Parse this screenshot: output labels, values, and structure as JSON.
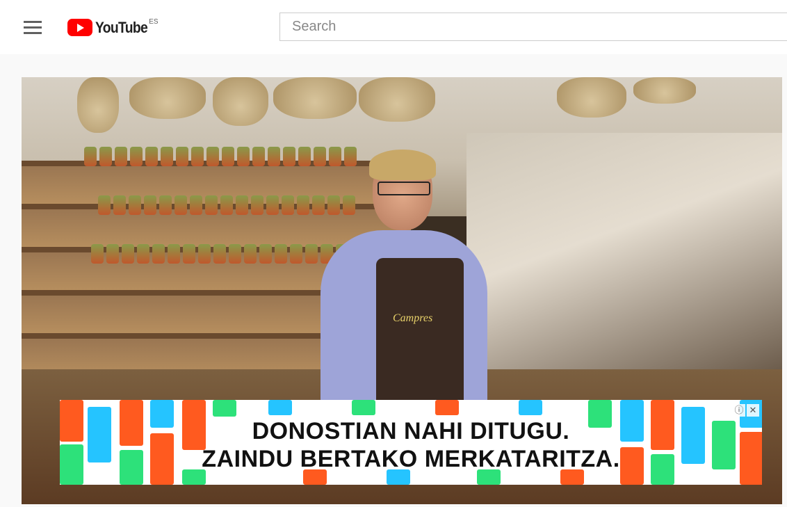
{
  "header": {
    "logo_text": "YouTube",
    "country_code": "ES",
    "search_placeholder": "Search"
  },
  "video": {
    "apron_text": "Campres"
  },
  "ad": {
    "line1": "DONOSTIAN NAHI DITUGU.",
    "line2": "ZAINDU BERTAKO MERKATARITZA.",
    "info_icon": "ⓘ",
    "close_icon": "✕",
    "tab_colors": [
      "#ff5a1f",
      "#25c4ff",
      "#2de17a",
      "#ff5a1f"
    ]
  },
  "colors": {
    "brand_red": "#ff0000"
  },
  "icons": {
    "menu": "hamburger-menu-icon",
    "logo": "youtube-logo-icon"
  }
}
